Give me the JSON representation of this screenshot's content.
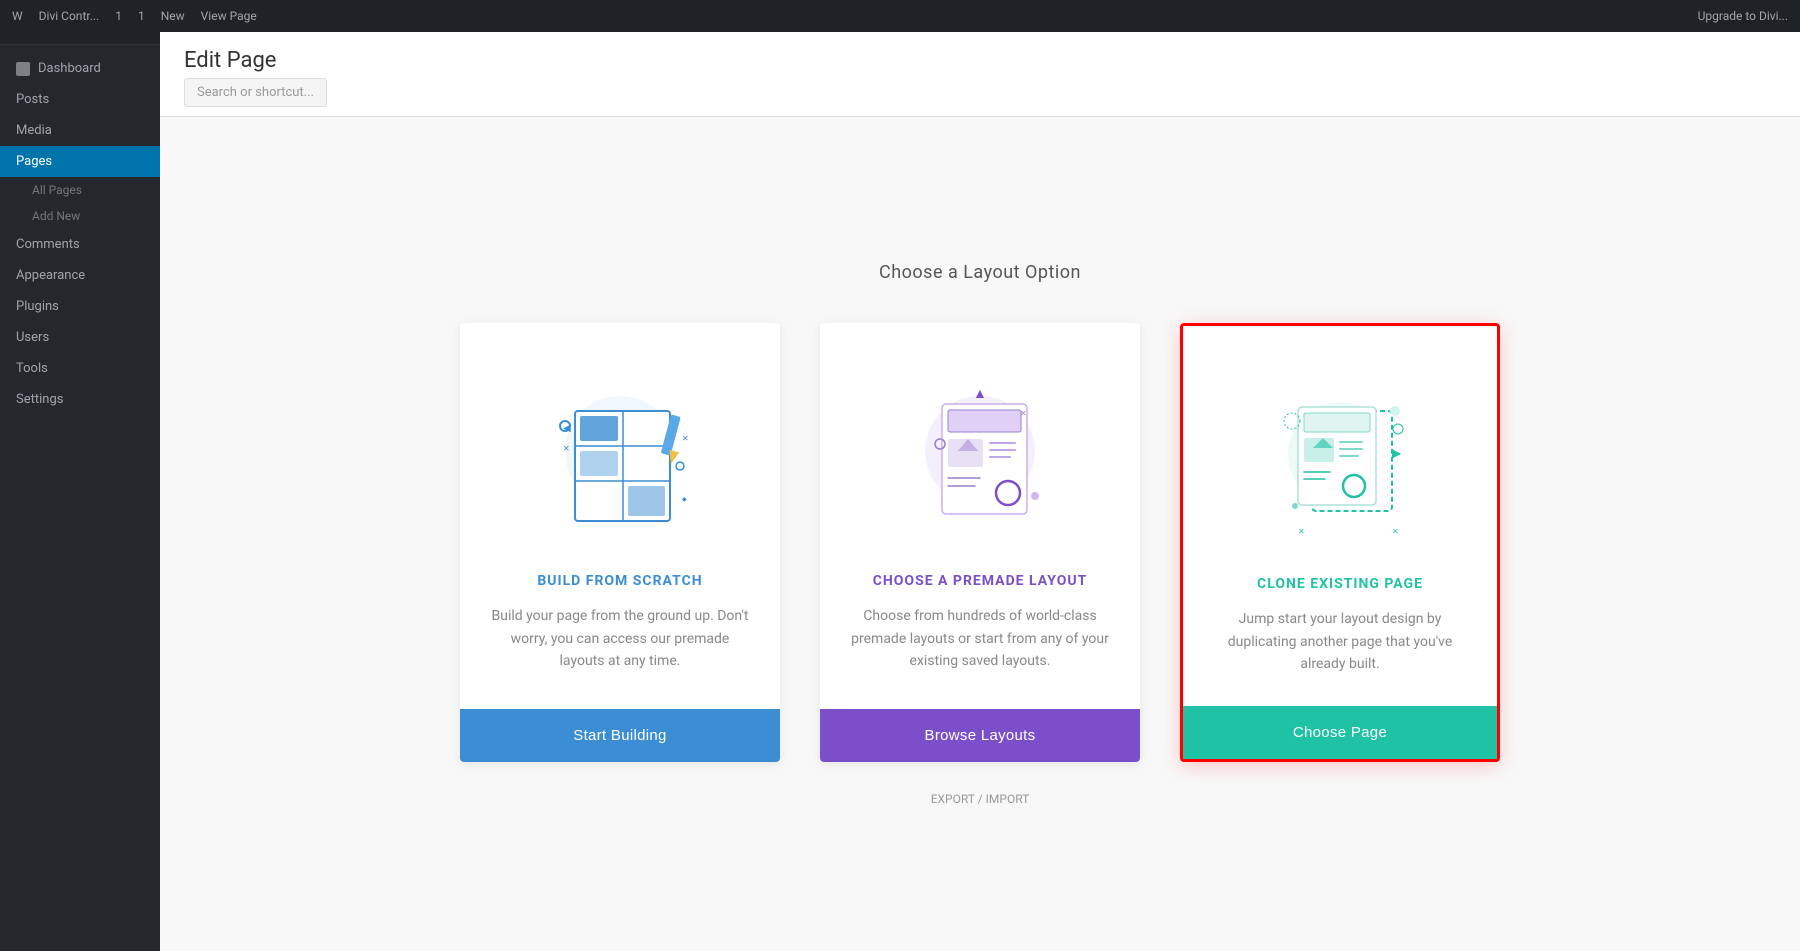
{
  "topbar": {
    "items": [
      "W",
      "Divi Contr...",
      "1",
      "1",
      "New",
      "View Page"
    ],
    "right_label": "Upgrade to Divi..."
  },
  "sidebar": {
    "logo_text": "Dashboard",
    "items": [
      {
        "id": "dashboard",
        "label": "Dashboard"
      },
      {
        "id": "posts",
        "label": "Posts"
      },
      {
        "id": "media",
        "label": "Media"
      },
      {
        "id": "pages",
        "label": "Pages",
        "active": true
      },
      {
        "id": "sub1",
        "label": "All Pages",
        "sub": true
      },
      {
        "id": "sub2",
        "label": "Add New",
        "sub": true
      },
      {
        "id": "comments",
        "label": "Comments"
      },
      {
        "id": "appearance",
        "label": "Appearance"
      },
      {
        "id": "plugins",
        "label": "Plugins"
      },
      {
        "id": "users",
        "label": "Users"
      },
      {
        "id": "tools",
        "label": "Tools"
      },
      {
        "id": "settings",
        "label": "Settings"
      }
    ]
  },
  "page": {
    "title": "Edit Page",
    "search_placeholder": "Search or shortcut...",
    "option_title": "Choose a Layout Option"
  },
  "cards": [
    {
      "id": "build-from-scratch",
      "heading": "BUILD FROM SCRATCH",
      "heading_color": "blue",
      "description": "Build your page from the ground up. Don't worry, you can access our premade layouts at any time.",
      "button_label": "Start Building",
      "button_color": "blue-btn",
      "selected": false
    },
    {
      "id": "choose-premade-layout",
      "heading": "CHOOSE A PREMADE LAYOUT",
      "heading_color": "purple",
      "description": "Choose from hundreds of world-class premade layouts or start from any of your existing saved layouts.",
      "button_label": "Browse Layouts",
      "button_color": "purple-btn",
      "selected": false
    },
    {
      "id": "clone-existing-page",
      "heading": "CLONE EXISTING PAGE",
      "heading_color": "teal",
      "description": "Jump start your layout design by duplicating another page that you've already built.",
      "button_label": "Choose Page",
      "button_color": "teal-btn",
      "selected": true
    }
  ],
  "footer": {
    "text": "EXPORT / IMPORT"
  }
}
